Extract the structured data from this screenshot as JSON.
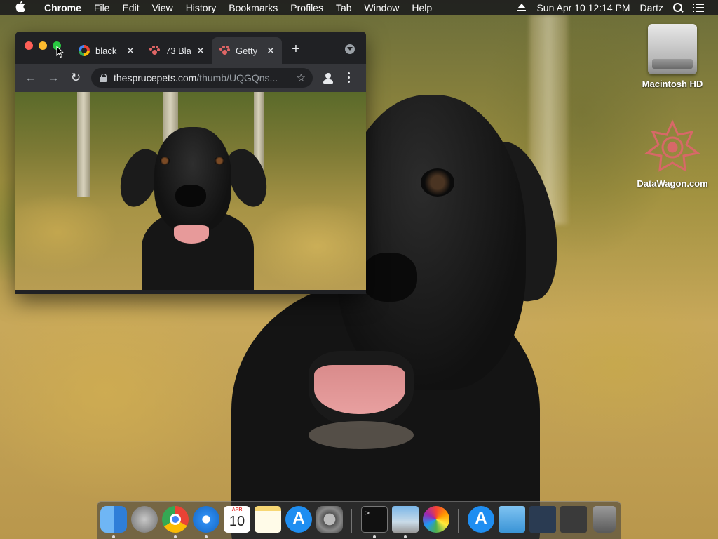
{
  "menubar": {
    "app_name": "Chrome",
    "items": [
      "File",
      "Edit",
      "View",
      "History",
      "Bookmarks",
      "Profiles",
      "Tab",
      "Window",
      "Help"
    ],
    "datetime": "Sun Apr 10  12:14 PM",
    "user": "Dartz"
  },
  "desktop": {
    "icons": [
      {
        "label": "Macintosh HD",
        "icon": "hard-drive-icon"
      },
      {
        "label": "DataWagon.com",
        "icon": "datawagon-icon"
      }
    ]
  },
  "browser": {
    "tabs": [
      {
        "title": "black",
        "favicon": "google-icon",
        "active": false
      },
      {
        "title": "73 Bla",
        "favicon": "paw-icon",
        "active": false
      },
      {
        "title": "Getty",
        "favicon": "paw-icon",
        "active": true
      }
    ],
    "new_tab_label": "+",
    "close_glyph": "✕",
    "url_host": "thesprucepets.com",
    "url_path": "/thumb/UQGQns...",
    "content": "black labrador retriever photo"
  },
  "dock": {
    "apps": [
      "Finder",
      "Launchpad",
      "Google Chrome",
      "Safari",
      "Calendar",
      "Notes",
      "App Store",
      "System Preferences",
      "Terminal",
      "Preview",
      "Photos",
      "App Store folder",
      "Documents",
      "Screenshots",
      "Downloads",
      "Trash"
    ],
    "calendar_month": "APR",
    "calendar_day": "10"
  },
  "colors": {
    "chrome_frame": "#202124",
    "chrome_toolbar": "#35363a",
    "menubar": "#1e1e1e"
  }
}
